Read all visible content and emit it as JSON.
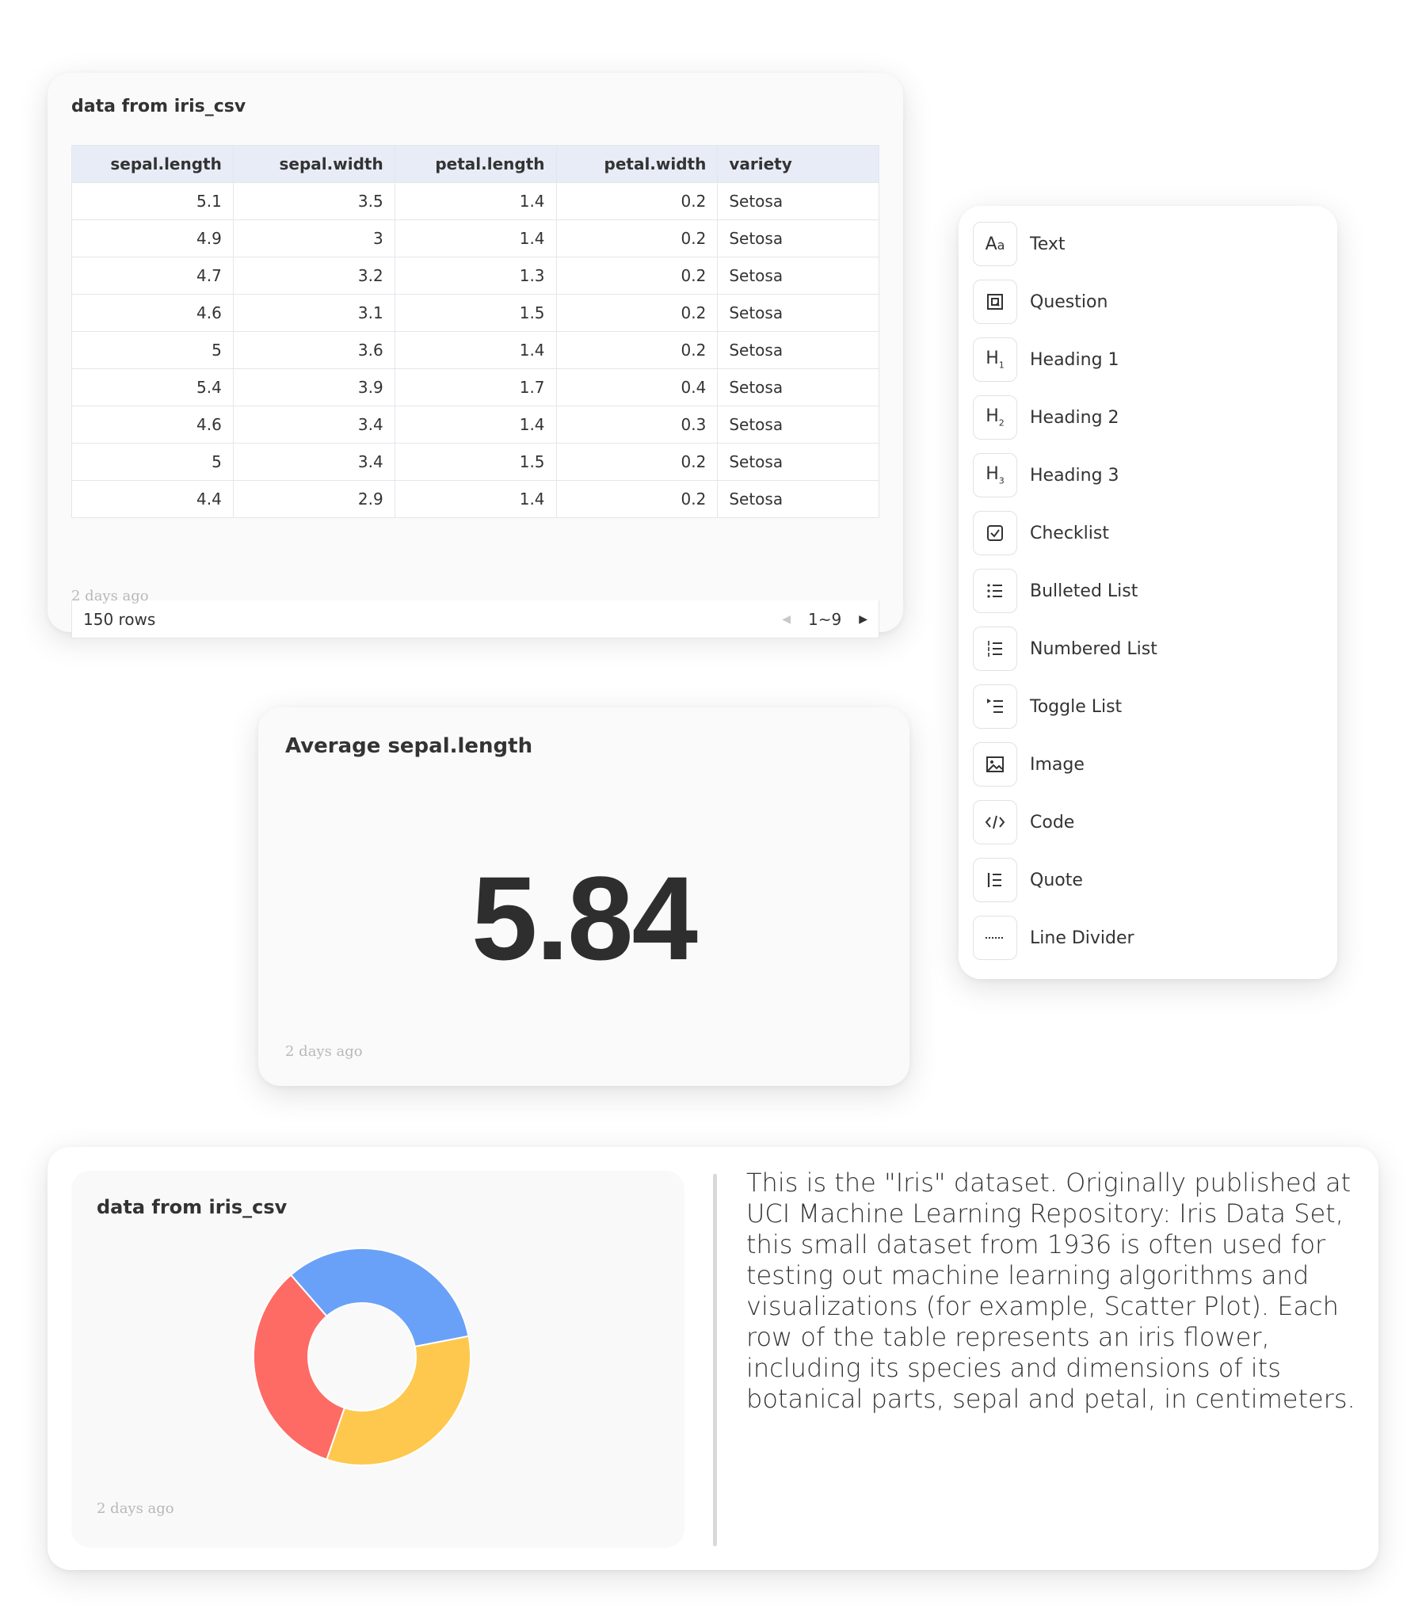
{
  "table_card": {
    "title": "data from iris_csv",
    "columns": [
      "sepal.length",
      "sepal.width",
      "petal.length",
      "petal.width",
      "variety"
    ],
    "rows": [
      [
        "5.1",
        "3.5",
        "1.4",
        "0.2",
        "Setosa"
      ],
      [
        "4.9",
        "3",
        "1.4",
        "0.2",
        "Setosa"
      ],
      [
        "4.7",
        "3.2",
        "1.3",
        "0.2",
        "Setosa"
      ],
      [
        "4.6",
        "3.1",
        "1.5",
        "0.2",
        "Setosa"
      ],
      [
        "5",
        "3.6",
        "1.4",
        "0.2",
        "Setosa"
      ],
      [
        "5.4",
        "3.9",
        "1.7",
        "0.4",
        "Setosa"
      ],
      [
        "4.6",
        "3.4",
        "1.4",
        "0.3",
        "Setosa"
      ],
      [
        "5",
        "3.4",
        "1.5",
        "0.2",
        "Setosa"
      ],
      [
        "4.4",
        "2.9",
        "1.4",
        "0.2",
        "Setosa"
      ]
    ],
    "row_count": "150 rows",
    "page_range": "1~9",
    "timestamp": "2 days ago"
  },
  "menu": {
    "items": [
      {
        "label": "Text",
        "icon": "text-icon"
      },
      {
        "label": "Question",
        "icon": "question-icon"
      },
      {
        "label": "Heading 1",
        "icon": "heading1-icon"
      },
      {
        "label": "Heading 2",
        "icon": "heading2-icon"
      },
      {
        "label": "Heading 3",
        "icon": "heading3-icon"
      },
      {
        "label": "Checklist",
        "icon": "checklist-icon"
      },
      {
        "label": "Bulleted List",
        "icon": "bulleted-list-icon"
      },
      {
        "label": "Numbered List",
        "icon": "numbered-list-icon"
      },
      {
        "label": "Toggle List",
        "icon": "toggle-list-icon"
      },
      {
        "label": "Image",
        "icon": "image-icon"
      },
      {
        "label": "Code",
        "icon": "code-icon"
      },
      {
        "label": "Quote",
        "icon": "quote-icon"
      },
      {
        "label": "Line Divider",
        "icon": "line-divider-icon"
      }
    ]
  },
  "metric_card": {
    "title": "Average sepal.length",
    "value": "5.84",
    "timestamp": "2 days ago"
  },
  "chart_card": {
    "title": "data from iris_csv",
    "timestamp": "2 days ago"
  },
  "chart_data": {
    "type": "pie",
    "donut": true,
    "title": "data from iris_csv",
    "slices": [
      {
        "value": 33.3,
        "color": "#6aa1f8"
      },
      {
        "value": 33.3,
        "color": "#fdc84d"
      },
      {
        "value": 33.3,
        "color": "#fe6b64"
      }
    ]
  },
  "description": "This is the \"Iris\" dataset. Originally published at UCI Machine Learning Repository: Iris Data Set, this small dataset from 1936 is often used for testing out machine learning algorithms and visualizations (for example, Scatter Plot). Each row of the table represents an iris flower, including its species and dimensions of its botanical parts, sepal and petal, in centimeters.",
  "colors": {
    "table_header_bg": "#e8ecf7",
    "donut_blue": "#6aa1f8",
    "donut_yellow": "#fdc84d",
    "donut_red": "#fe6b64"
  }
}
